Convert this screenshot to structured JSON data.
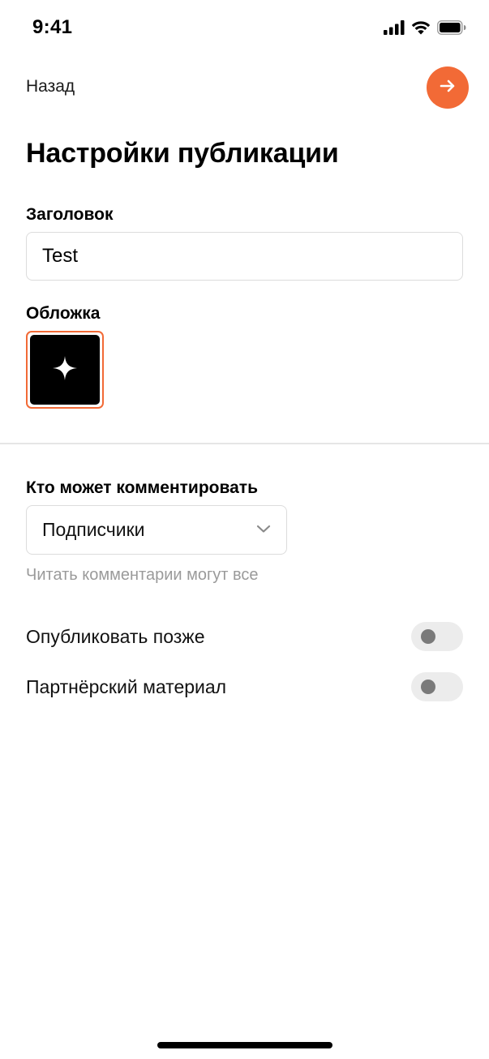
{
  "status_bar": {
    "time": "9:41",
    "icons": [
      "signal-icon",
      "wifi-icon",
      "battery-icon"
    ]
  },
  "header": {
    "back_label": "Назад",
    "next_icon": "arrow-right-icon"
  },
  "page": {
    "title": "Настройки публикации"
  },
  "form": {
    "title_label": "Заголовок",
    "title_value": "Test",
    "cover_label": "Обложка",
    "cover_icon": "sparkle-icon",
    "comments_label": "Кто может комментировать",
    "comments_selected": "Подписчики",
    "comments_hint": "Читать комментарии могут все",
    "toggles": [
      {
        "label": "Опубликовать позже",
        "on": false
      },
      {
        "label": "Партнёрский материал",
        "on": false
      }
    ]
  },
  "colors": {
    "accent": "#f26a36",
    "border": "#dcdcdc",
    "hint": "#9a9a9a",
    "switch_track": "#ececec",
    "switch_knob": "#7a7a7a"
  }
}
